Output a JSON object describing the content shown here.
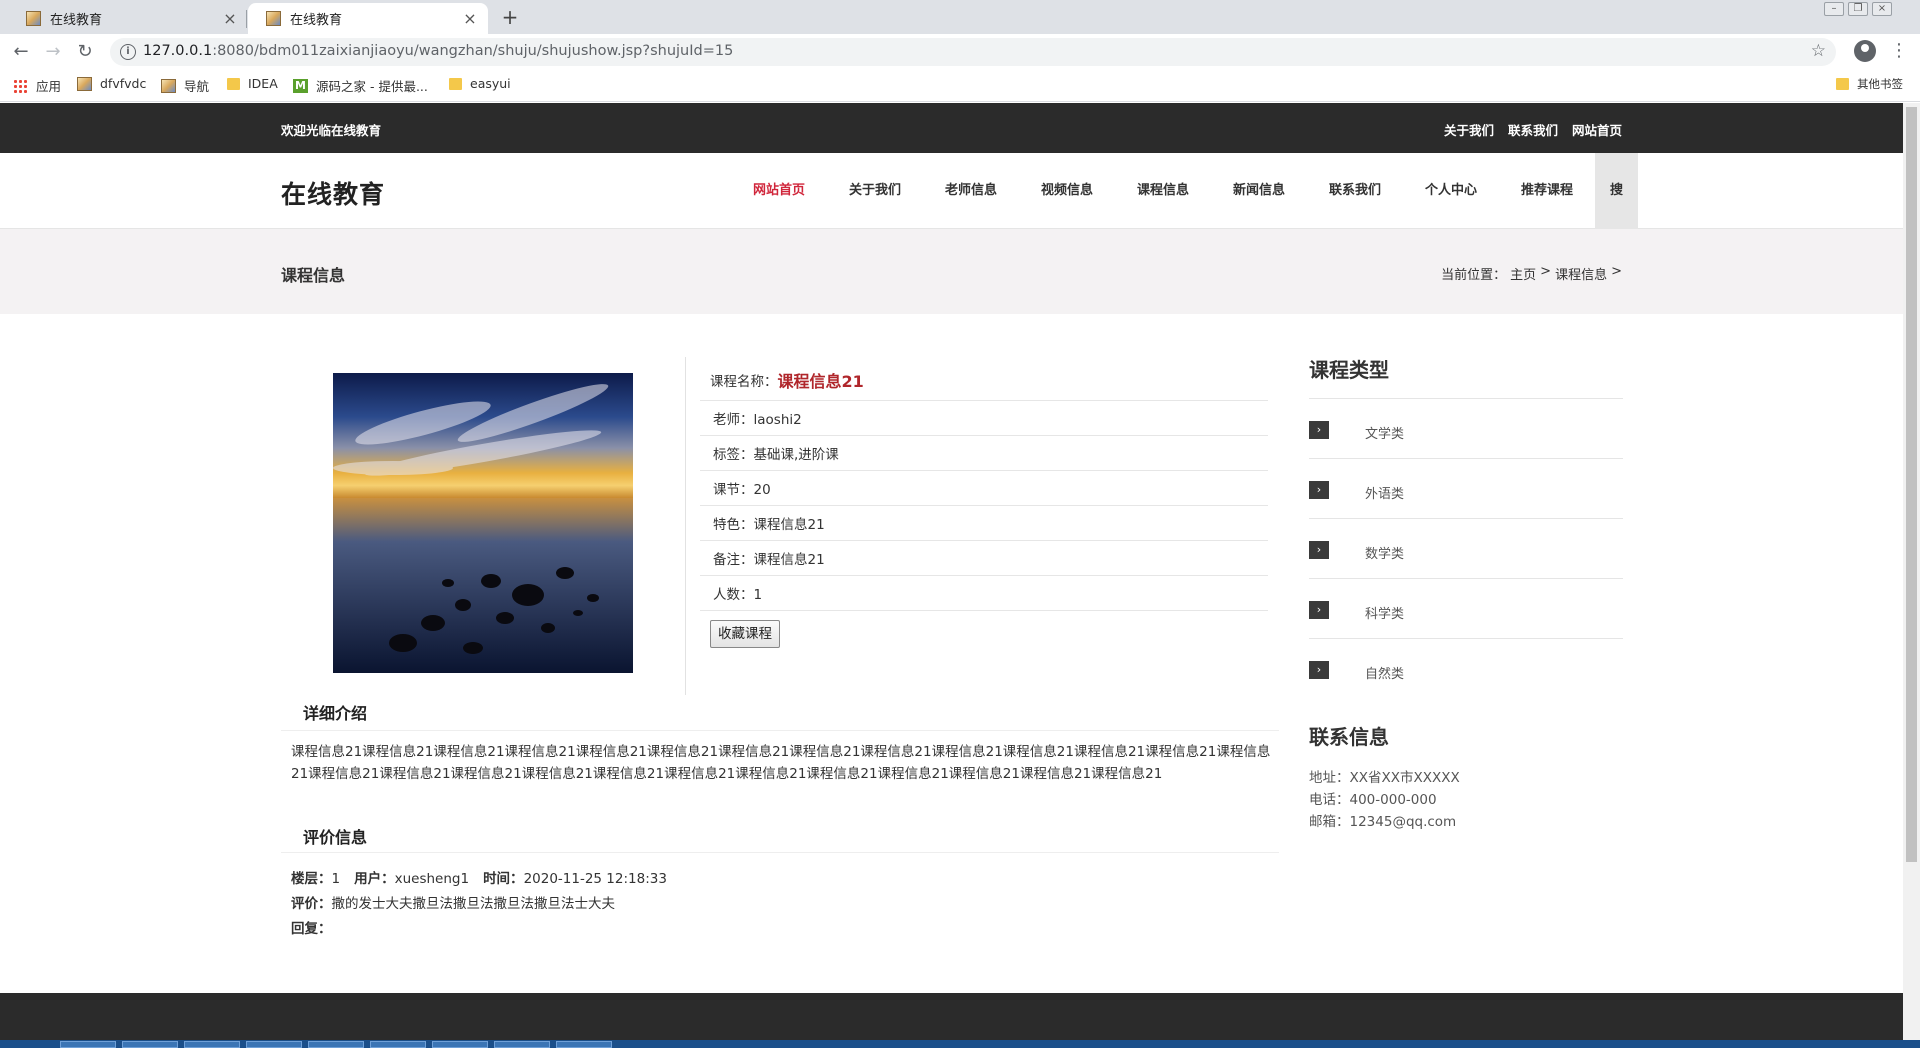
{
  "browser": {
    "tabs": [
      {
        "title": "在线教育",
        "active": false
      },
      {
        "title": "在线教育",
        "active": true
      }
    ],
    "new_tab": "+",
    "url_host": "127.0.0.1",
    "url_path": ":8080/bdm011zaixianjiaoyu/wangzhan/shuju/shujushow.jsp?shujuId=15",
    "bookmarks": [
      {
        "label": "应用",
        "icon": "apps-grid-icon"
      },
      {
        "label": "dfvfvdc",
        "icon": "page-icon"
      },
      {
        "label": "导航",
        "icon": "page-icon"
      },
      {
        "label": "IDEA",
        "icon": "folder-icon"
      },
      {
        "label": "源码之家 - 提供最...",
        "icon": "m-logo-icon"
      },
      {
        "label": "easyui",
        "icon": "folder-icon"
      }
    ],
    "other_bookmarks": "其他书签"
  },
  "site": {
    "welcome": "欢迎光临在线教育",
    "top_links": [
      "关于我们",
      "联系我们",
      "网站首页"
    ],
    "logo": "在线教育",
    "nav": [
      "网站首页",
      "关于我们",
      "老师信息",
      "视频信息",
      "课程信息",
      "新闻信息",
      "联系我们",
      "个人中心",
      "推荐课程"
    ],
    "nav_search": "搜",
    "banner_title": "课程信息",
    "breadcrumb": {
      "prefix": "当前位置：",
      "home": "主页",
      "sep1": ">",
      "current": "课程信息",
      "sep2": ">"
    }
  },
  "course": {
    "name_label": "课程名称：",
    "name": "课程信息21",
    "teacher": "老师：laoshi2",
    "tags": "标签：基础课,进阶课",
    "lessons": "课节：20",
    "feature": "特色：课程信息21",
    "note": "备注：课程信息21",
    "people": "人数：1",
    "fav_button": "收藏课程"
  },
  "intro": {
    "title": "详细介绍",
    "text": "课程信息21课程信息21课程信息21课程信息21课程信息21课程信息21课程信息21课程信息21课程信息21课程信息21课程信息21课程信息21课程信息21课程信息21课程信息21课程信息21课程信息21课程信息21课程信息21课程信息21课程信息21课程信息21课程信息21课程信息21课程信息21课程信息21"
  },
  "review": {
    "title": "评价信息",
    "floor_label": "楼层：",
    "floor": "1",
    "user_label": "用户：",
    "user": "xuesheng1",
    "time_label": "时间：",
    "time": "2020-11-25 12:18:33",
    "comment_label": "评价：",
    "comment": "撒的发士大夫撒旦法撒旦法撒旦法撒旦法士大夫",
    "reply_label": "回复："
  },
  "sidebar": {
    "type_title": "课程类型",
    "types": [
      "文学类",
      "外语类",
      "数学类",
      "科学类",
      "自然类"
    ],
    "contact_title": "联系信息",
    "address": "地址：XX省XX市XXXXX",
    "phone": "电话：400-000-000",
    "email": "邮箱：12345@qq.com"
  },
  "colors": {
    "topbar": "#2b2b2b",
    "accent": "#d0263b",
    "course_name": "#b0262b",
    "banner_bg": "#f4f2f3"
  }
}
